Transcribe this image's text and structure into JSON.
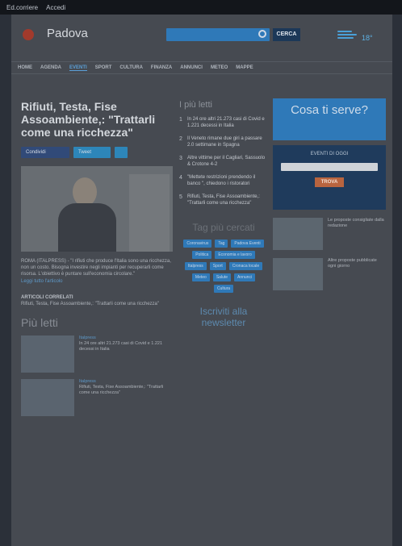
{
  "topbar": {
    "items": [
      "Ed.corriere",
      "Accedi"
    ]
  },
  "header": {
    "city": "Padova",
    "search_button": "CERCA",
    "weather_temp": "18°"
  },
  "nav": {
    "items": [
      "HOME",
      "AGENDA",
      "EVENTI",
      "SPORT",
      "CULTURA",
      "FINANZA",
      "ANNUNCI",
      "METEO",
      "MAPPE"
    ],
    "active": 2
  },
  "article": {
    "title": "Rifiuti, Testa, Fise Assoambiente,: \"Trattarli come una ricchezza\"",
    "share_fb": "Condividi",
    "share_tw": "Tweet",
    "lead": "ROMA (ITALPRESS) - \"I rifiuti che produce l'Italia sono una ricchezza, non un costo. Bisogna investire negli impianti per recuperarli come risorsa. L'obiettivo è puntare sull'economia circolare.\"",
    "readmore": "Leggi tutto l'articolo"
  },
  "related": {
    "heading": "ARTICOLI CORRELATI",
    "items": [
      "Rifiuti, Testa, Fise Assoambiente,: \"Trattarli come una ricchezza\""
    ]
  },
  "videos": {
    "heading": "Più letti",
    "items": [
      {
        "kicker": "Italpress",
        "text": "In 24 ore altri 21.273 casi di Covid e 1.221 decessi in Italia"
      },
      {
        "kicker": "Italpress",
        "text": "Rifiuti, Testa, Fise Assoambiente,: \"Trattarli come una ricchezza\""
      }
    ]
  },
  "mostread": {
    "heading": "I più letti",
    "items": [
      {
        "n": "1",
        "title": "In 24 ore altri 21.273 casi di Covid e 1.221 decessi in Italia"
      },
      {
        "n": "2",
        "title": "Il Veneto rimane due giri a passare 2.0 settimane in Spagna"
      },
      {
        "n": "3",
        "title": "Altre vittime per il Cagliari, Sassuolo & Crotone 4-2"
      },
      {
        "n": "4",
        "title": "\"Mettete restrizioni prendendo il banco \", chiedono i ristoratori"
      },
      {
        "n": "5",
        "title": "Rifiuti, Testa, Fise Assoambiente,: \"Trattarli come una ricchezza\""
      }
    ]
  },
  "tags": {
    "heading": "Tag più cercati",
    "items": [
      "Coronavirus",
      "Tag",
      "Padova Eventi",
      "Politica",
      "Economia e lavoro",
      "Italpress",
      "Sport",
      "Cronaca locale",
      "Meteo",
      "Salute",
      "Annunci",
      "Cultura"
    ]
  },
  "newsletter": {
    "heading": "Iscriviti alla newsletter"
  },
  "sidebar": {
    "cosa_title": "Cosa ti serve?",
    "event_title": "EVENTI DI OGGI",
    "event_button": "TROVA",
    "promos": [
      {
        "text": "Le proposte consigliate dalla redazione"
      },
      {
        "text": "Altre proposte pubblicate ogni giorno"
      }
    ]
  }
}
